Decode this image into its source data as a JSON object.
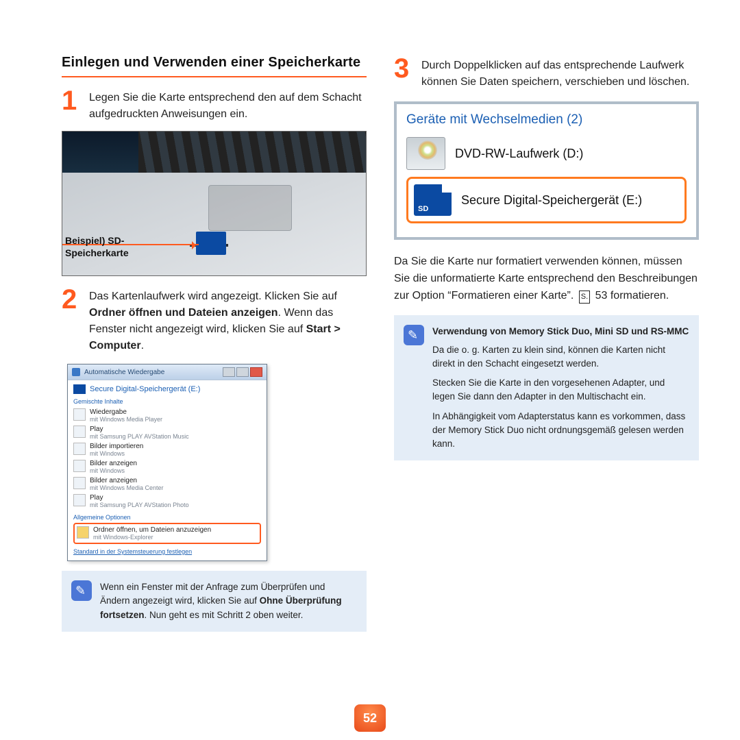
{
  "page_number": "52",
  "left": {
    "heading": "Einlegen und Verwenden einer Speicherkarte",
    "step1": {
      "num": "1",
      "text": "Legen Sie die Karte entsprechend den auf dem Schacht aufgedruckten Anweisungen ein."
    },
    "photo_label": "Beispiel) SD-\nSpeicherkarte",
    "step2": {
      "num": "2",
      "parts": [
        "Das Kartenlaufwerk wird angezeigt. Klicken Sie auf ",
        "Ordner öffnen und Dateien anzeigen",
        ". Wenn das Fenster nicht angezeigt wird, klicken Sie auf ",
        "Start > Computer",
        "."
      ]
    },
    "dialog": {
      "title": "Automatische Wiedergabe",
      "device": "Secure Digital-Speichergerät (E:)",
      "sec1": "Gemischte Inhalte",
      "opts": [
        {
          "t1": "Wiedergabe",
          "t2": "mit Windows Media Player"
        },
        {
          "t1": "Play",
          "t2": "mit Samsung PLAY AVStation Music"
        },
        {
          "t1": "Bilder importieren",
          "t2": "mit Windows"
        },
        {
          "t1": "Bilder anzeigen",
          "t2": "mit Windows"
        },
        {
          "t1": "Bilder anzeigen",
          "t2": "mit Windows Media Center"
        },
        {
          "t1": "Play",
          "t2": "mit Samsung PLAY AVStation Photo"
        }
      ],
      "sec2": "Allgemeine Optionen",
      "opt_hl": {
        "t1": "Ordner öffnen, um Dateien anzuzeigen",
        "t2": "mit Windows-Explorer"
      },
      "link": "Standard in der Systemsteuerung festlegen"
    },
    "tip": {
      "parts": [
        "Wenn ein Fenster mit der Anfrage zum Überprüfen und Ändern angezeigt wird, klicken Sie auf ",
        "Ohne Überprüfung fortsetzen",
        ". Nun geht es mit Schritt 2 oben weiter."
      ]
    }
  },
  "right": {
    "step3": {
      "num": "3",
      "text": "Durch Doppelklicken auf das entsprechende Laufwerk können Sie Daten speichern, verschieben und löschen."
    },
    "panel": {
      "heading": "Geräte mit Wechselmedien (2)",
      "dev1": "DVD-RW-Laufwerk (D:)",
      "dev2": "Secure Digital-Speichergerät (E:)"
    },
    "para": {
      "parts": [
        "Da Sie die Karte nur formatiert verwenden können, müssen Sie die unformatierte Karte entsprechend den Beschreibungen zur Option “Formatieren einer Karte”. ",
        "S.",
        " 53 formatieren."
      ]
    },
    "tip": {
      "title": "Verwendung von Memory Stick Duo, Mini SD und RS-MMC",
      "p1": "Da die o. g. Karten zu klein sind, können die Karten nicht direkt in den Schacht eingesetzt werden.",
      "p2": "Stecken Sie die Karte in den vorgesehenen Adapter, und legen Sie dann den Adapter in den Multischacht ein.",
      "p3": "In Abhängigkeit vom Adapterstatus kann es vorkommen, dass der Memory Stick Duo nicht ordnungsgemäß gelesen werden kann."
    }
  }
}
